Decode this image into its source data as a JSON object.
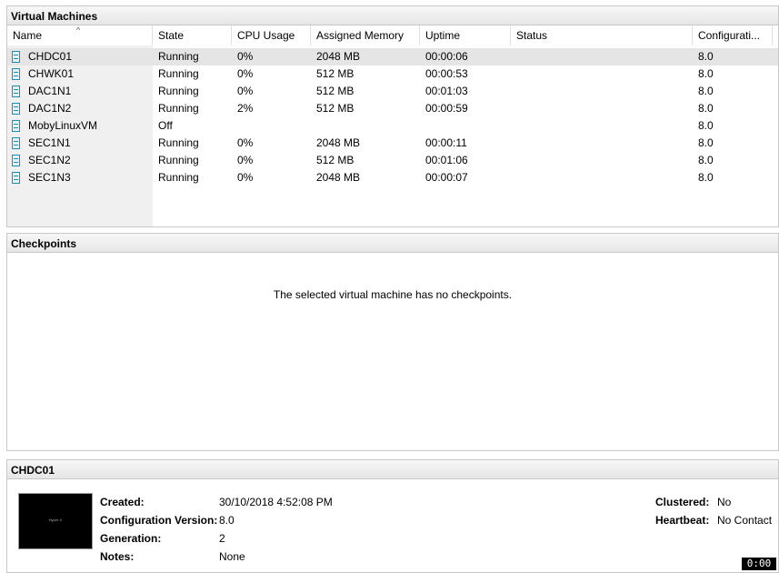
{
  "vm_panel": {
    "title": "Virtual Machines",
    "columns": [
      "Name",
      "State",
      "CPU Usage",
      "Assigned Memory",
      "Uptime",
      "Status",
      "Configurati..."
    ],
    "rows": [
      {
        "name": "CHDC01",
        "state": "Running",
        "cpu": "0%",
        "memory": "2048 MB",
        "uptime": "00:00:06",
        "status": "",
        "config": "8.0"
      },
      {
        "name": "CHWK01",
        "state": "Running",
        "cpu": "0%",
        "memory": "512 MB",
        "uptime": "00:00:53",
        "status": "",
        "config": "8.0"
      },
      {
        "name": "DAC1N1",
        "state": "Running",
        "cpu": "0%",
        "memory": "512 MB",
        "uptime": "00:01:03",
        "status": "",
        "config": "8.0"
      },
      {
        "name": "DAC1N2",
        "state": "Running",
        "cpu": "2%",
        "memory": "512 MB",
        "uptime": "00:00:59",
        "status": "",
        "config": "8.0"
      },
      {
        "name": "MobyLinuxVM",
        "state": "Off",
        "cpu": "",
        "memory": "",
        "uptime": "",
        "status": "",
        "config": "8.0"
      },
      {
        "name": "SEC1N1",
        "state": "Running",
        "cpu": "0%",
        "memory": "2048 MB",
        "uptime": "00:00:11",
        "status": "",
        "config": "8.0"
      },
      {
        "name": "SEC1N2",
        "state": "Running",
        "cpu": "0%",
        "memory": "512 MB",
        "uptime": "00:01:06",
        "status": "",
        "config": "8.0"
      },
      {
        "name": "SEC1N3",
        "state": "Running",
        "cpu": "0%",
        "memory": "2048 MB",
        "uptime": "00:00:07",
        "status": "",
        "config": "8.0"
      }
    ]
  },
  "checkpoints_panel": {
    "title": "Checkpoints",
    "empty_message": "The selected virtual machine has no checkpoints."
  },
  "details_panel": {
    "title": "CHDC01",
    "thumbnail_text": "Hyper-V",
    "created_label": "Created:",
    "created_value": "30/10/2018 4:52:08 PM",
    "config_version_label": "Configuration Version:",
    "config_version_value": "8.0",
    "generation_label": "Generation:",
    "generation_value": "2",
    "notes_label": "Notes:",
    "notes_value": "None",
    "clustered_label": "Clustered:",
    "clustered_value": "No",
    "heartbeat_label": "Heartbeat:",
    "heartbeat_value": "No Contact"
  },
  "clock": "0:00"
}
